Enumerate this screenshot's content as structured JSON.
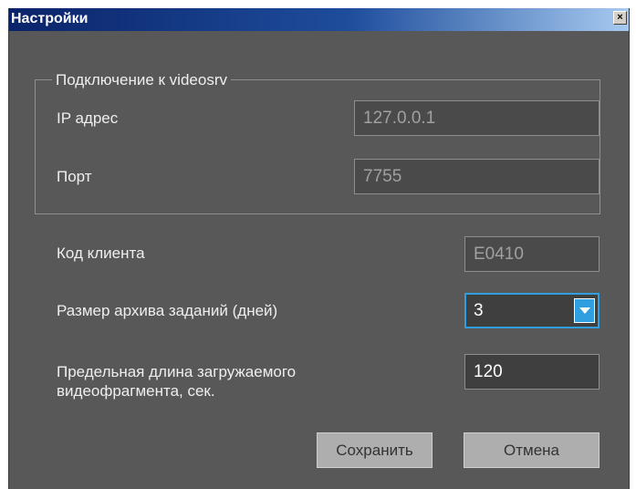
{
  "window": {
    "title": "Настройки",
    "close_glyph": "×"
  },
  "connection_group": {
    "title": "Подключение к videosrv",
    "ip_label": "IP адрес",
    "ip_value": "127.0.0.1",
    "port_label": "Порт",
    "port_value": "7755"
  },
  "client_code": {
    "label": "Код клиента",
    "value": "E0410"
  },
  "archive_size": {
    "label": "Размер архива заданий (дней)",
    "value": "3"
  },
  "max_fragment": {
    "label_line1": "Предельная длина загружаемого",
    "label_line2": "видеофрагмента, сек.",
    "value": "120"
  },
  "buttons": {
    "save": "Сохранить",
    "cancel": "Отмена"
  },
  "colors": {
    "background": "#585858",
    "accent": "#2f9fe0",
    "titlebar": "#0a246a"
  },
  "icons": {
    "close": "close-icon",
    "dropdown": "chevron-down-icon"
  }
}
